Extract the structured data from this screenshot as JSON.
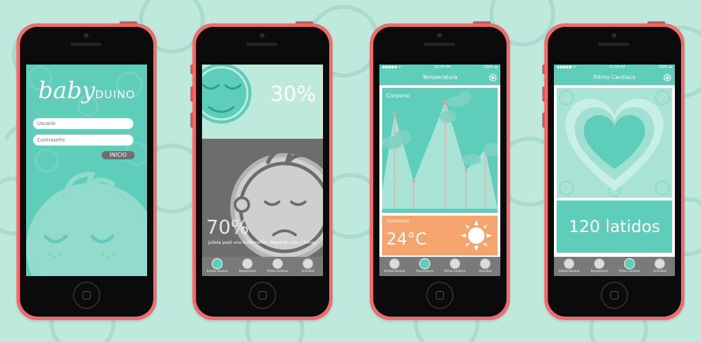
{
  "colors": {
    "teal": "#5ecdb9",
    "mint": "#bfe9dd",
    "orange": "#f6a46e",
    "phone": "#ef6c6c",
    "gray": "#7a7a7a"
  },
  "login": {
    "logo_baby": "baby",
    "logo_duino": "DUINO",
    "username_placeholder": "Usuario",
    "password_placeholder": "Contraseña",
    "start_button": "INICIO"
  },
  "status_bar": {
    "carrier": "●●●●● ᯤ",
    "time": "12:24 PM",
    "battery": "100% ▬"
  },
  "summary": {
    "good_percent": "30%",
    "bad_percent": "70%",
    "caption": "Julieta pasó una mala noche, despertó cada 2 horas."
  },
  "temperature": {
    "title": "Temperatura",
    "body_label": "Corporal",
    "ambient_label": "Ambiente",
    "ambient_value": "24°C"
  },
  "heart": {
    "title": "Ritmo Cardiaco",
    "beats": "120 latidos"
  },
  "tabs": [
    {
      "label": "Estado General",
      "icon": "baby-face-icon"
    },
    {
      "label": "Temperatura",
      "icon": "sun-icon"
    },
    {
      "label": "Ritmo Cardiaco",
      "icon": "heart-icon"
    },
    {
      "label": "Actividad",
      "icon": "bar-chart-icon"
    }
  ]
}
